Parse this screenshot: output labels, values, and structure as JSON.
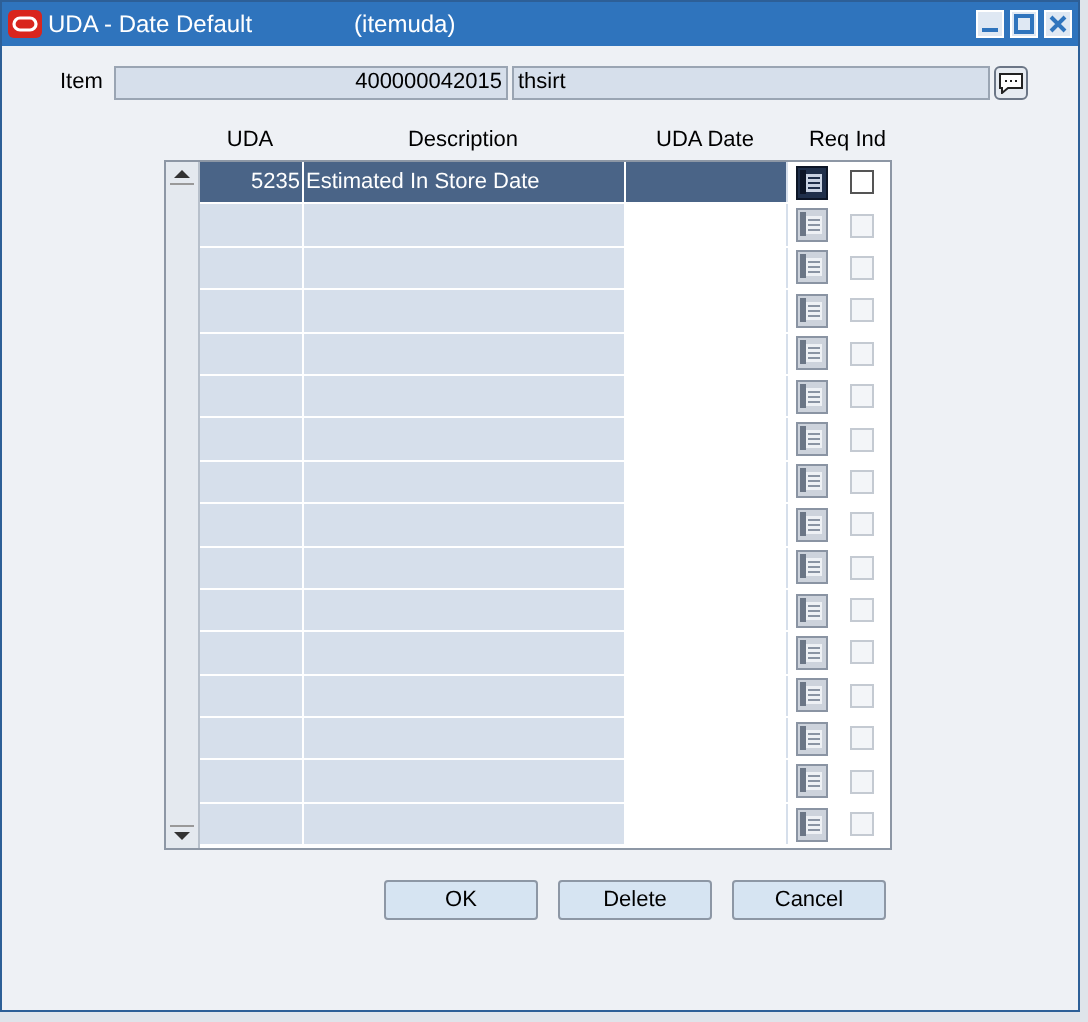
{
  "window": {
    "title": "UDA - Date Default",
    "form_name": "(itemuda)"
  },
  "item": {
    "label": "Item",
    "number": "400000042015",
    "description": "thsirt"
  },
  "table": {
    "columns": [
      "UDA",
      "Description",
      "UDA Date",
      "Req Ind"
    ],
    "rows": [
      {
        "uda": "5235",
        "description": "Estimated In Store Date",
        "selected": true,
        "req_ind": false,
        "disabled": false
      },
      {
        "selected": false,
        "req_ind": false,
        "disabled": true
      },
      {
        "selected": false,
        "req_ind": false,
        "disabled": true
      },
      {
        "selected": false,
        "req_ind": false,
        "disabled": true
      },
      {
        "selected": false,
        "req_ind": false,
        "disabled": true
      },
      {
        "selected": false,
        "req_ind": false,
        "disabled": true
      },
      {
        "selected": false,
        "req_ind": false,
        "disabled": true
      },
      {
        "selected": false,
        "req_ind": false,
        "disabled": true
      },
      {
        "selected": false,
        "req_ind": false,
        "disabled": true
      },
      {
        "selected": false,
        "req_ind": false,
        "disabled": true
      },
      {
        "selected": false,
        "req_ind": false,
        "disabled": true
      },
      {
        "selected": false,
        "req_ind": false,
        "disabled": true
      },
      {
        "selected": false,
        "req_ind": false,
        "disabled": true
      },
      {
        "selected": false,
        "req_ind": false,
        "disabled": true
      },
      {
        "selected": false,
        "req_ind": false,
        "disabled": true
      },
      {
        "selected": false,
        "req_ind": false,
        "disabled": true
      }
    ]
  },
  "buttons": [
    "OK",
    "Delete",
    "Cancel"
  ]
}
